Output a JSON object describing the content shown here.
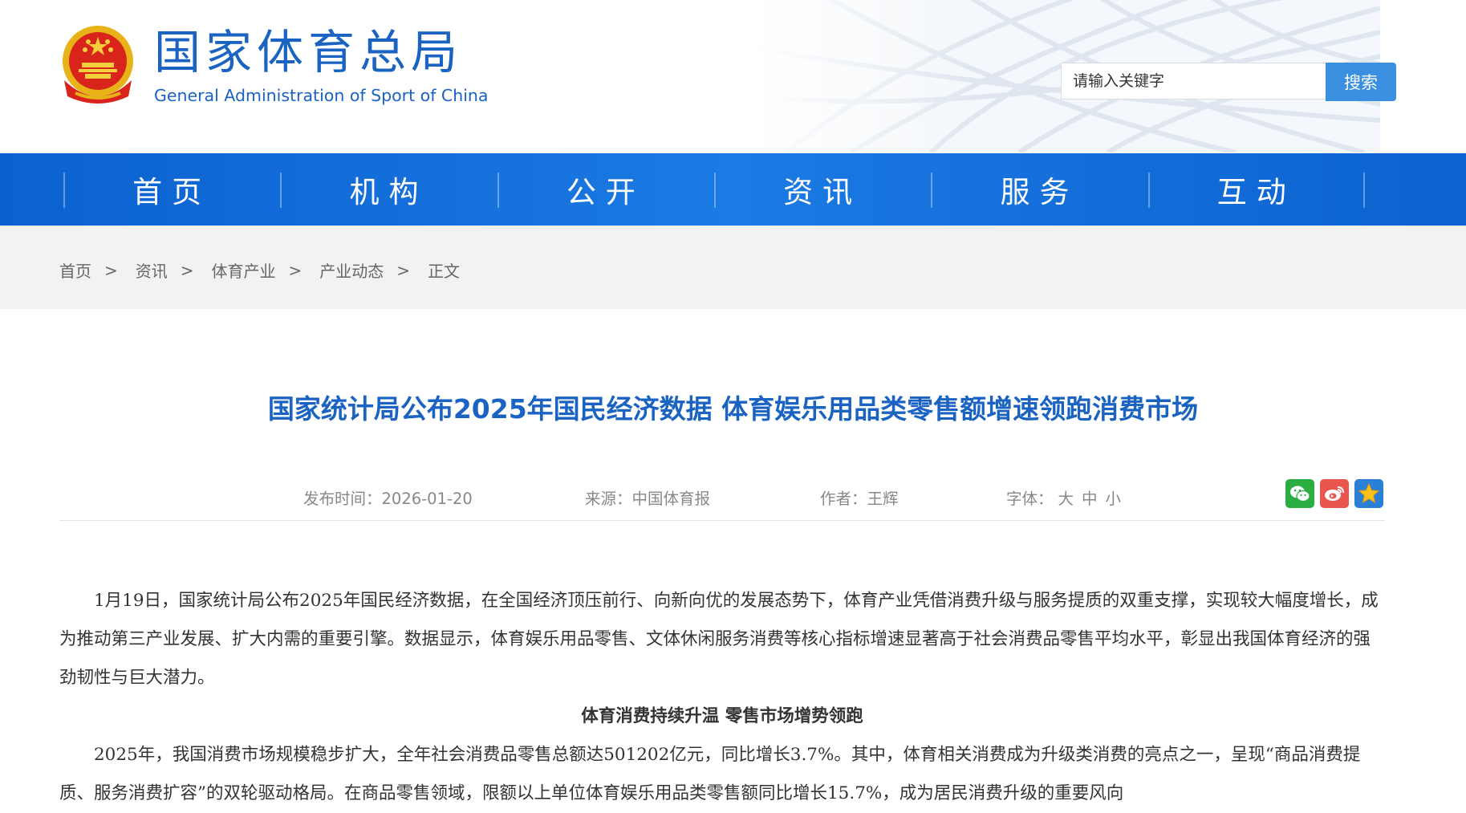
{
  "header": {
    "site_title_cn": "国家体育总局",
    "site_title_en": "General Administration of Sport of China",
    "logo_icon": "national-emblem-icon"
  },
  "search": {
    "placeholder": "请输入关键字",
    "button_label": "搜索"
  },
  "nav": {
    "items": [
      {
        "label": "首页"
      },
      {
        "label": "机构"
      },
      {
        "label": "公开"
      },
      {
        "label": "资讯"
      },
      {
        "label": "服务"
      },
      {
        "label": "互动"
      }
    ]
  },
  "breadcrumb": {
    "items": [
      "首页",
      "资讯",
      "体育产业",
      "产业动态",
      "正文"
    ],
    "separator": ">"
  },
  "article": {
    "title": "国家统计局公布2025年国民经济数据 体育娱乐用品类零售额增速领跑消费市场",
    "meta": {
      "publish_label": "发布时间：",
      "publish_date": "2026-01-20",
      "source_label": "来源：",
      "source": "中国体育报",
      "author_label": "作者：",
      "author": "王辉",
      "font_label": "字体：",
      "font_large": "大",
      "font_medium": "中",
      "font_small": "小"
    },
    "share_icons": [
      "wechat-icon",
      "weibo-icon",
      "favorite-icon"
    ],
    "paragraph_1": "1月19日，国家统计局公布2025年国民经济数据，在全国经济顶压前行、向新向优的发展态势下，体育产业凭借消费升级与服务提质的双重支撑，实现较大幅度增长，成为推动第三产业发展、扩大内需的重要引擎。数据显示，体育娱乐用品零售、文体休闲服务消费等核心指标增速显著高于社会消费品零售平均水平，彰显出我国体育经济的强劲韧性与巨大潜力。",
    "subheading_1": "体育消费持续升温 零售市场增势领跑",
    "paragraph_2": "2025年，我国消费市场规模稳步扩大，全年社会消费品零售总额达501202亿元，同比增长3.7%。其中，体育相关消费成为升级类消费的亮点之一，呈现“商品消费提质、服务消费扩容”的双轮驱动格局。在商品零售领域，限额以上单位体育娱乐用品类零售额同比增长15.7%，成为居民消费升级的重要风向"
  },
  "colors": {
    "brand_blue": "#1a63c2",
    "nav_blue": "#1170db",
    "search_button": "#3b8fe1",
    "wechat_green": "#2aae41",
    "weibo_red": "#e8564e",
    "favorite_blue": "#2a7fd6"
  }
}
